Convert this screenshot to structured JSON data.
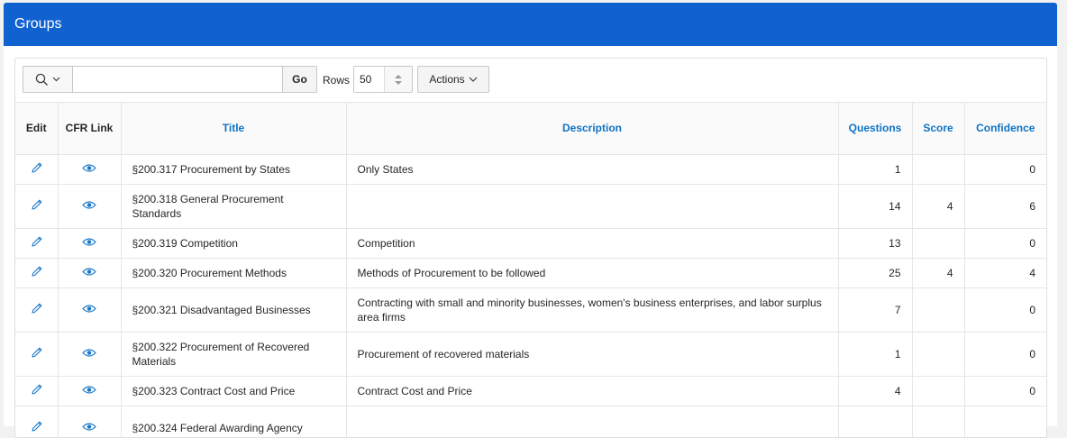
{
  "region": {
    "title": "Groups"
  },
  "toolbar": {
    "search_value": "",
    "go_label": "Go",
    "rows_label": "Rows",
    "rows_value": "50",
    "actions_label": "Actions"
  },
  "table": {
    "headers": {
      "edit": "Edit",
      "cfr_link": "CFR Link",
      "title": "Title",
      "description": "Description",
      "questions": "Questions",
      "score": "Score",
      "confidence": "Confidence"
    },
    "rows": [
      {
        "title": "§200.317 Procurement by States",
        "description": "Only States",
        "questions": "1",
        "score": "",
        "confidence": "0"
      },
      {
        "title": "§200.318 General Procurement Standards",
        "description": "",
        "questions": "14",
        "score": "4",
        "confidence": "6"
      },
      {
        "title": "§200.319 Competition",
        "description": "Competition",
        "questions": "13",
        "score": "",
        "confidence": "0"
      },
      {
        "title": "§200.320 Procurement Methods",
        "description": "Methods of Procurement to be followed",
        "questions": "25",
        "score": "4",
        "confidence": "4"
      },
      {
        "title": "§200.321 Disadvantaged Businesses",
        "description": "Contracting with small and minority businesses, women's business enterprises, and labor surplus area firms",
        "questions": "7",
        "score": "",
        "confidence": "0"
      },
      {
        "title": "§200.322 Procurement of Recovered Materials",
        "description": "Procurement of recovered materials",
        "questions": "1",
        "score": "",
        "confidence": "0"
      },
      {
        "title": "§200.323 Contract Cost and Price",
        "description": "Contract Cost and Price",
        "questions": "4",
        "score": "",
        "confidence": "0"
      },
      {
        "title": "§200.324 Federal Awarding Agency",
        "description": "",
        "questions": "",
        "score": "",
        "confidence": ""
      }
    ]
  },
  "icons": {
    "edit": "pencil-icon",
    "view": "eye-icon",
    "search": "search-icon",
    "chevron": "chevron-down-icon",
    "sort": "sort-arrows-icon"
  },
  "colors": {
    "header_bg": "#1062d1",
    "link": "#0e73c4"
  }
}
